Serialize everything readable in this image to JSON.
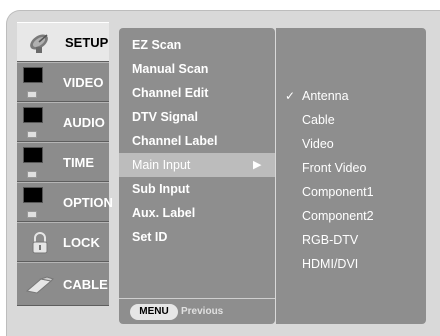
{
  "tabs": [
    {
      "label": "SETUP",
      "icon": "satellite-dish-icon",
      "active": true
    },
    {
      "label": "VIDEO",
      "icon": "video-screen-icon",
      "active": false
    },
    {
      "label": "AUDIO",
      "icon": "audio-screen-icon",
      "active": false
    },
    {
      "label": "TIME",
      "icon": "clock-screen-icon",
      "active": false
    },
    {
      "label": "OPTION",
      "icon": "option-screen-icon",
      "active": false
    },
    {
      "label": "LOCK",
      "icon": "padlock-icon",
      "active": false
    },
    {
      "label": "CABLE",
      "icon": "cable-icon",
      "active": false
    }
  ],
  "menu": {
    "items": [
      "EZ Scan",
      "Manual  Scan",
      "Channel Edit",
      "DTV Signal",
      "Channel  Label",
      "Main Input",
      "Sub Input",
      "Aux. Label",
      "Set ID"
    ],
    "selected_index": 5,
    "selected_arrow": "▶"
  },
  "navbar": {
    "menu_key": "MENU",
    "previous_label": "Previous"
  },
  "options": {
    "items": [
      "Antenna",
      "Cable",
      "Video",
      "Front Video",
      "Component1",
      "Component2",
      "RGB-DTV",
      "HDMI/DVI"
    ],
    "checked_index": 0,
    "check_mark": "✓"
  },
  "colors": {
    "panel": "#8e8e8e",
    "tab_inactive": "#8c8c8c",
    "tab_active": "#e8e8e8",
    "frame": "#d9d9d9",
    "highlight": "#bcbcbc"
  }
}
